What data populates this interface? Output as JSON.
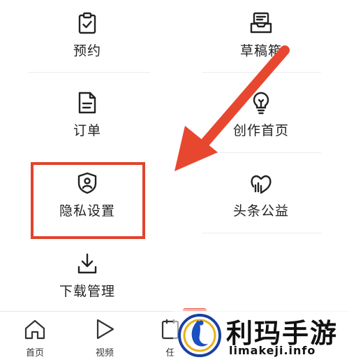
{
  "menu": {
    "items": [
      {
        "label": "预约",
        "icon": "clipboard-check-icon"
      },
      {
        "label": "草稿箱",
        "icon": "drafts-tray-icon"
      },
      {
        "label": "订单",
        "icon": "document-icon"
      },
      {
        "label": "创作首页",
        "icon": "lightbulb-icon"
      },
      {
        "label": "隐私设置",
        "icon": "shield-user-icon"
      },
      {
        "label": "头条公益",
        "icon": "charity-heart-icon"
      },
      {
        "label": "下载管理",
        "icon": "download-icon"
      }
    ]
  },
  "highlight": {
    "target": "隐私设置",
    "color": "#e0442c"
  },
  "bottom_nav": {
    "items": [
      {
        "label": "首页",
        "icon": "home-icon"
      },
      {
        "label": "视频",
        "icon": "play-icon"
      },
      {
        "label": "任",
        "icon": "task-icon"
      }
    ]
  },
  "watermark": {
    "title": "利玛手游",
    "url": "limakeji.info"
  }
}
